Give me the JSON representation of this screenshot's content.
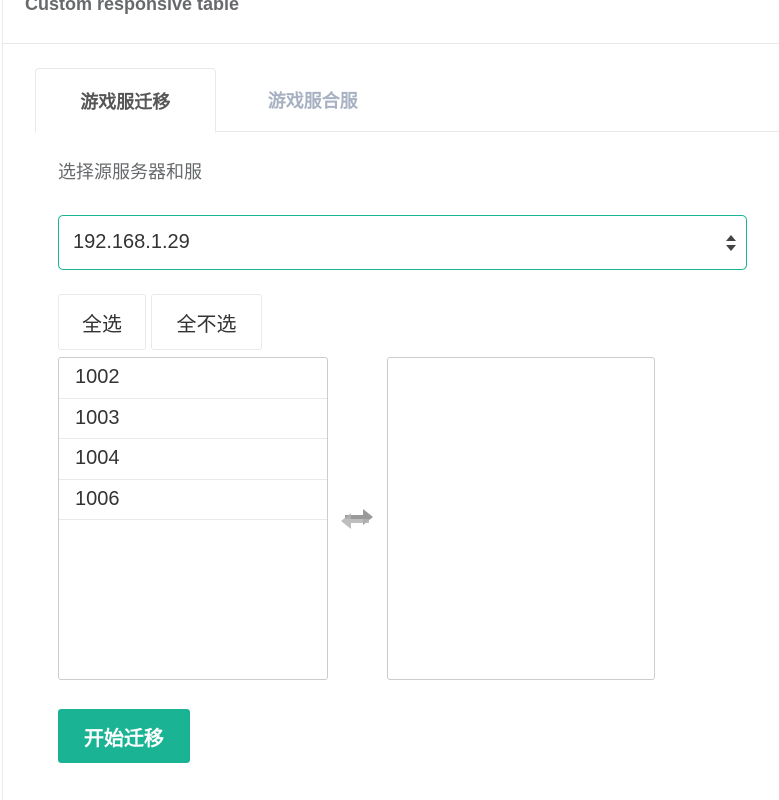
{
  "panel": {
    "title": "Custom responsive table"
  },
  "tabs": [
    {
      "label": "游戏服迁移",
      "active": true
    },
    {
      "label": "游戏服合服",
      "active": false
    }
  ],
  "form": {
    "source_label": "选择源服务器和服",
    "server_select": {
      "selected": "192.168.1.29"
    },
    "select_all_label": "全选",
    "select_none_label": "全不选",
    "available_list": [
      "1002",
      "1003",
      "1004",
      "1006"
    ],
    "selected_list": [],
    "submit_label": "开始迁移"
  },
  "colors": {
    "accent": "#1ab394",
    "tab_inactive_text": "#a7b1c2",
    "border": "#e7eaec",
    "swap_icon": "#999999"
  },
  "icons": {
    "swap": "swap-arrows-icon",
    "select_arrows": "select-updown-icon"
  }
}
